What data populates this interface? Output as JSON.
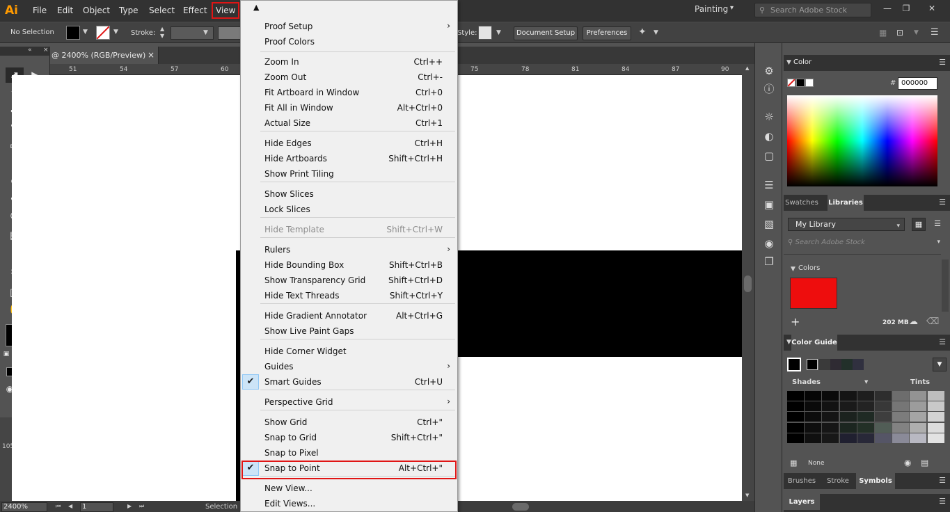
{
  "app": {
    "logo": "Ai"
  },
  "menubar": {
    "items": [
      "File",
      "Edit",
      "Object",
      "Type",
      "Select",
      "Effect",
      "View"
    ],
    "workspace": "Painting",
    "stock_search_placeholder": "Search Adobe Stock"
  },
  "controlbar": {
    "selection_label": "No Selection",
    "stroke_label": "Stroke:",
    "style_label": "Style:",
    "document_setup": "Document Setup",
    "preferences": "Preferences"
  },
  "document": {
    "tab_title": "@ 2400% (RGB/Preview)",
    "close": "×"
  },
  "ruler": {
    "h_ticks": [
      "51",
      "54",
      "57",
      "60",
      "75",
      "78",
      "81",
      "84",
      "87",
      "90"
    ],
    "v_label": "105"
  },
  "statusbar": {
    "zoom": "2400%",
    "page": "1",
    "tool": "Selection"
  },
  "view_menu": {
    "items": [
      {
        "label": "Proof Setup",
        "shortcut": "",
        "submenu": true
      },
      {
        "label": "Proof Colors",
        "shortcut": ""
      },
      {
        "label": "Zoom In",
        "shortcut": "Ctrl++"
      },
      {
        "label": "Zoom Out",
        "shortcut": "Ctrl+-"
      },
      {
        "label": "Fit Artboard in Window",
        "shortcut": "Ctrl+0"
      },
      {
        "label": "Fit All in Window",
        "shortcut": "Alt+Ctrl+0"
      },
      {
        "label": "Actual Size",
        "shortcut": "Ctrl+1"
      },
      {
        "label": "Hide Edges",
        "shortcut": "Ctrl+H"
      },
      {
        "label": "Hide Artboards",
        "shortcut": "Shift+Ctrl+H"
      },
      {
        "label": "Show Print Tiling",
        "shortcut": ""
      },
      {
        "label": "Show Slices",
        "shortcut": ""
      },
      {
        "label": "Lock Slices",
        "shortcut": ""
      },
      {
        "label": "Hide Template",
        "shortcut": "Shift+Ctrl+W",
        "disabled": true
      },
      {
        "label": "Rulers",
        "shortcut": "",
        "submenu": true
      },
      {
        "label": "Hide Bounding Box",
        "shortcut": "Shift+Ctrl+B"
      },
      {
        "label": "Show Transparency Grid",
        "shortcut": "Shift+Ctrl+D"
      },
      {
        "label": "Hide Text Threads",
        "shortcut": "Shift+Ctrl+Y"
      },
      {
        "label": "Hide Gradient Annotator",
        "shortcut": "Alt+Ctrl+G"
      },
      {
        "label": "Show Live Paint Gaps",
        "shortcut": ""
      },
      {
        "label": "Hide Corner Widget",
        "shortcut": ""
      },
      {
        "label": "Guides",
        "shortcut": "",
        "submenu": true
      },
      {
        "label": "Smart Guides",
        "shortcut": "Ctrl+U",
        "checked": true
      },
      {
        "label": "Perspective Grid",
        "shortcut": "",
        "submenu": true
      },
      {
        "label": "Show Grid",
        "shortcut": "Ctrl+\""
      },
      {
        "label": "Snap to Grid",
        "shortcut": "Shift+Ctrl+\""
      },
      {
        "label": "Snap to Pixel",
        "shortcut": ""
      },
      {
        "label": "Snap to Point",
        "shortcut": "Alt+Ctrl+\"",
        "checked": true
      },
      {
        "label": "New View...",
        "shortcut": ""
      },
      {
        "label": "Edit Views...",
        "shortcut": ""
      }
    ]
  },
  "color_panel": {
    "title": "Color",
    "hash": "#",
    "hex": "000000"
  },
  "libraries_panel": {
    "tabs": [
      "Swatches",
      "Libraries"
    ],
    "library": "My Library",
    "search_placeholder": "Search Adobe Stock",
    "section": "Colors",
    "swatch_color": "#ee0d0d",
    "storage": "202 MB"
  },
  "color_guide": {
    "title": "Color Guide",
    "shades": "Shades",
    "tints": "Tints",
    "none": "None"
  },
  "bottom_panels": {
    "tabs": [
      "Brushes",
      "Stroke",
      "Symbols"
    ],
    "layers": "Layers"
  },
  "colors": {
    "accent_red": "#e01515",
    "check_bg": "#cce4f7"
  }
}
